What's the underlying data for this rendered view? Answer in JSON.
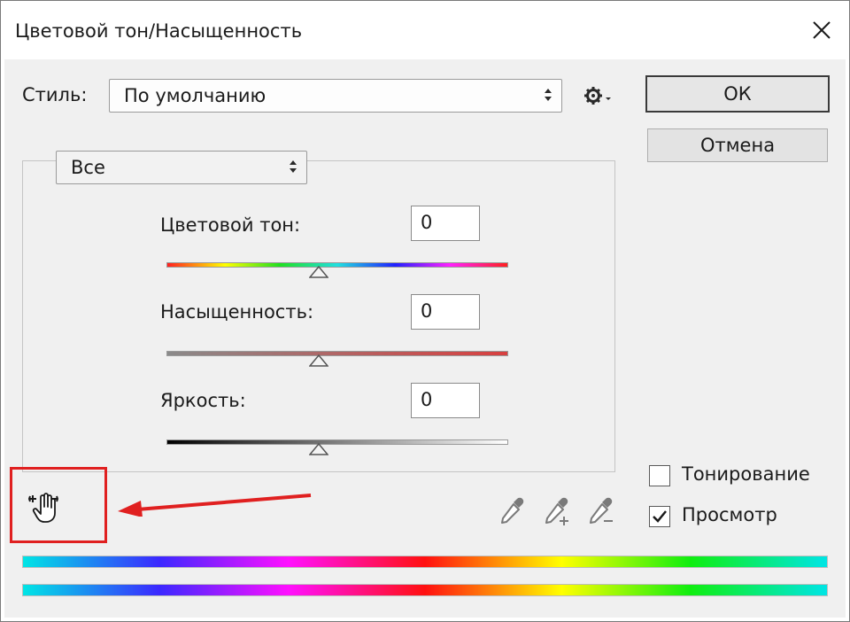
{
  "window": {
    "title": "Цветовой тон/Насыщенность"
  },
  "style": {
    "label": "Стиль:",
    "value": "По умолчанию"
  },
  "buttons": {
    "ok": "ОК",
    "cancel": "Отмена"
  },
  "channel": {
    "value": "Все"
  },
  "adjustments": {
    "hue": {
      "label": "Цветовой тон:",
      "value": "0"
    },
    "saturation": {
      "label": "Насыщенность:",
      "value": "0"
    },
    "lightness": {
      "label": "Яркость:",
      "value": "0"
    }
  },
  "options": {
    "colorize": {
      "label": "Тонирование",
      "checked": false
    },
    "preview": {
      "label": "Просмотр",
      "checked": true
    }
  },
  "icons": [
    "close-icon",
    "updown-arrows-icon",
    "gear-menu-icon",
    "targeted-adjustment-hand-icon",
    "eyedropper-icon",
    "eyedropper-plus-icon",
    "eyedropper-minus-icon"
  ],
  "colors": {
    "annotation": "#e02020"
  }
}
